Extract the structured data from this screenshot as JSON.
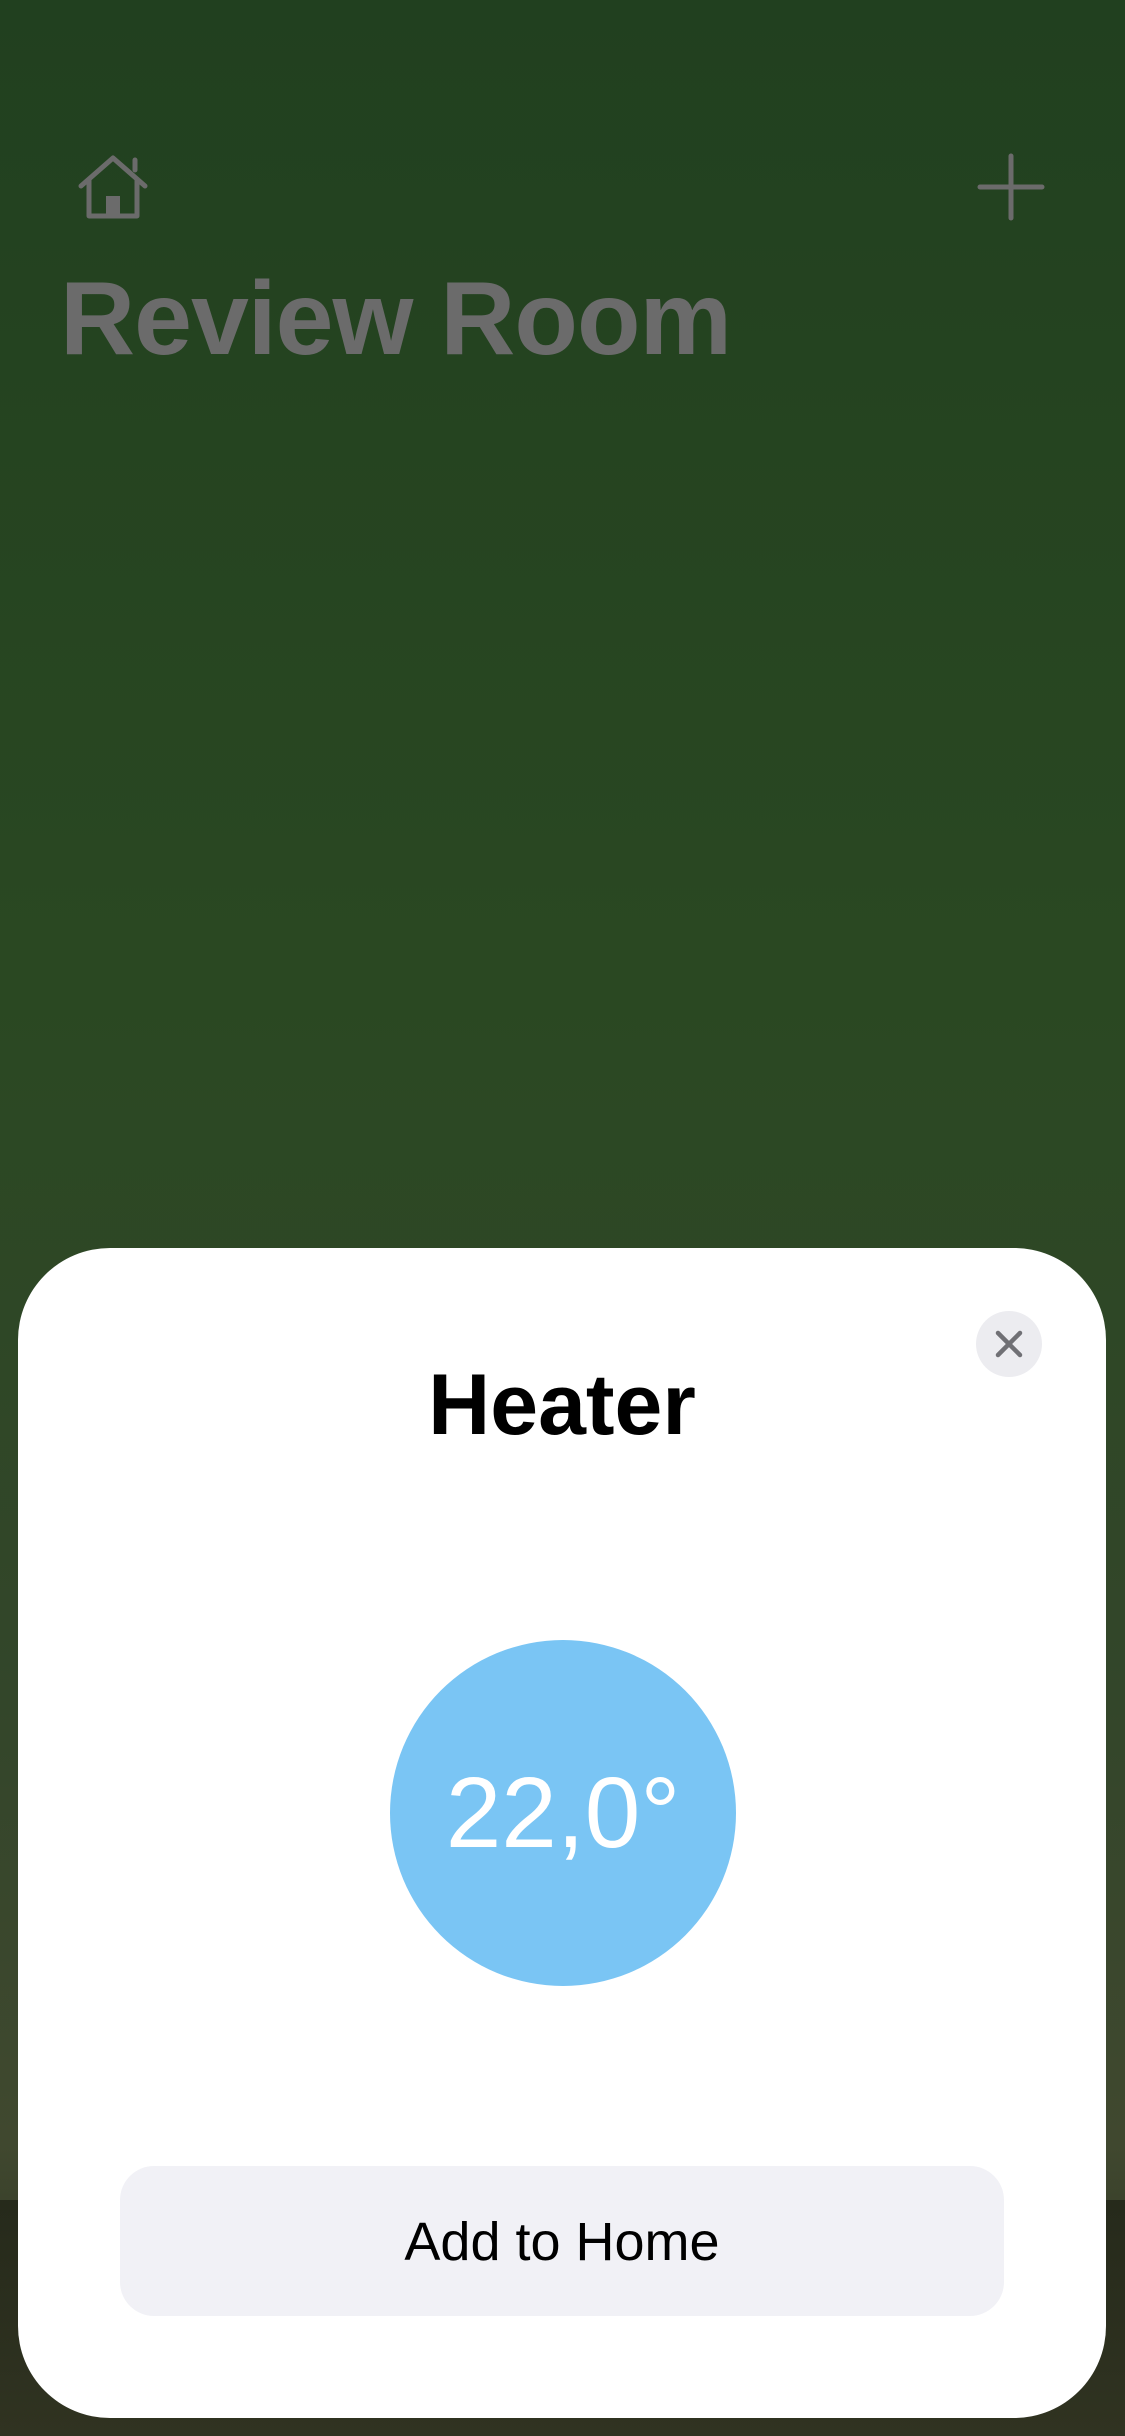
{
  "header": {
    "home_icon": "home-icon",
    "add_icon": "plus-icon",
    "room_title": "Review Room"
  },
  "sheet": {
    "title": "Heater",
    "temperature": "22,0°",
    "add_button_label": "Add to Home",
    "close_icon": "close-icon"
  },
  "colors": {
    "background_green": "#21401f",
    "dial_blue": "#7ac5f4",
    "button_gray": "#f1f1f6",
    "dimmed_text": "#6b6b6b"
  }
}
